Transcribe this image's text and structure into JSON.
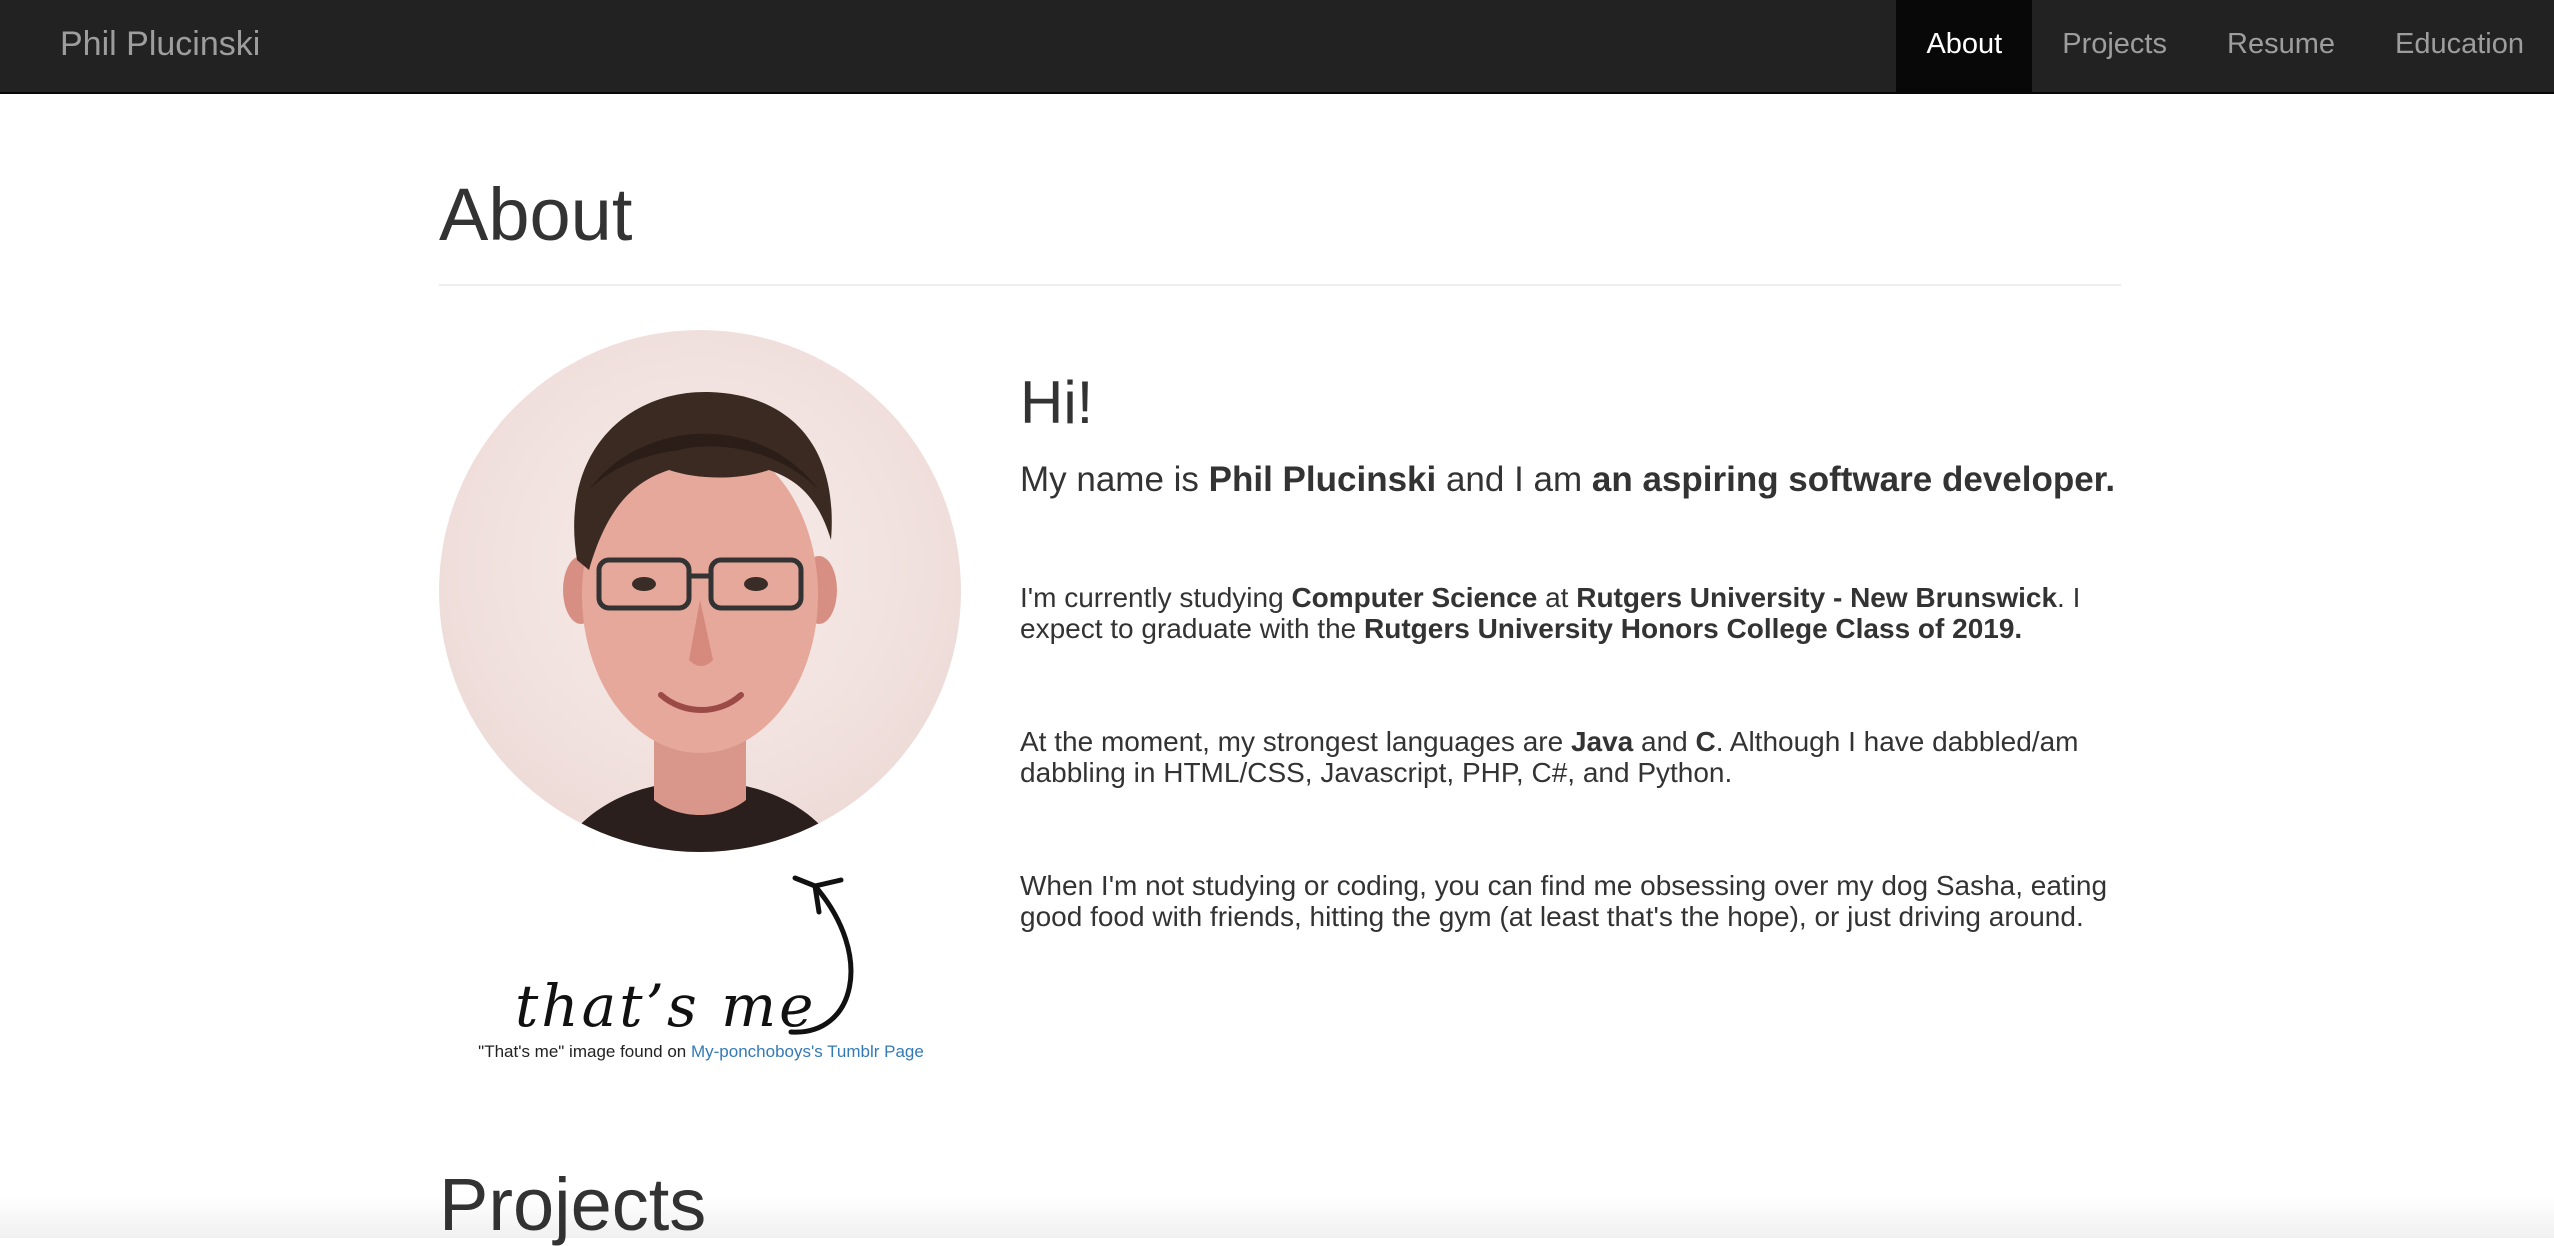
{
  "navbar": {
    "brand": "Phil Plucinski",
    "items": [
      {
        "label": "About",
        "active": true
      },
      {
        "label": "Projects",
        "active": false
      },
      {
        "label": "Resume",
        "active": false
      },
      {
        "label": "Education",
        "active": false
      }
    ]
  },
  "about": {
    "title": "About",
    "photo": {
      "annotation": "that’s me",
      "credit_prefix": "\"That's me\" image found on ",
      "credit_link": "My-ponchoboys's Tumblr Page"
    },
    "greeting": "Hi!",
    "intro": {
      "t1": "My name is ",
      "b1": "Phil Plucinski",
      "t2": " and I am ",
      "b2": "an aspiring software developer."
    },
    "study": {
      "t1": "I'm currently studying ",
      "b1": "Computer Science",
      "t2": " at ",
      "b2": "Rutgers University - New Brunswick",
      "t3": ". I expect to graduate with the ",
      "b3": "Rutgers University Honors College Class of 2019."
    },
    "languages": {
      "t1": "At the moment, my strongest languages are ",
      "b1": "Java",
      "t2": " and ",
      "b2": "C",
      "t3": ". Although I have dabbled/am dabbling in HTML/CSS, Javascript, PHP, C#, and Python."
    },
    "hobbies": "When I'm not studying or coding, you can find me obsessing over my dog Sasha, eating good food with friends, hitting the gym (at least that's the hope), or just driving around."
  },
  "projects": {
    "title": "Projects"
  },
  "colors": {
    "navbar_bg": "#222222",
    "nav_active_bg": "#080808",
    "nav_text": "#9d9d9d",
    "link": "#337ab7",
    "body_text": "#333333"
  }
}
